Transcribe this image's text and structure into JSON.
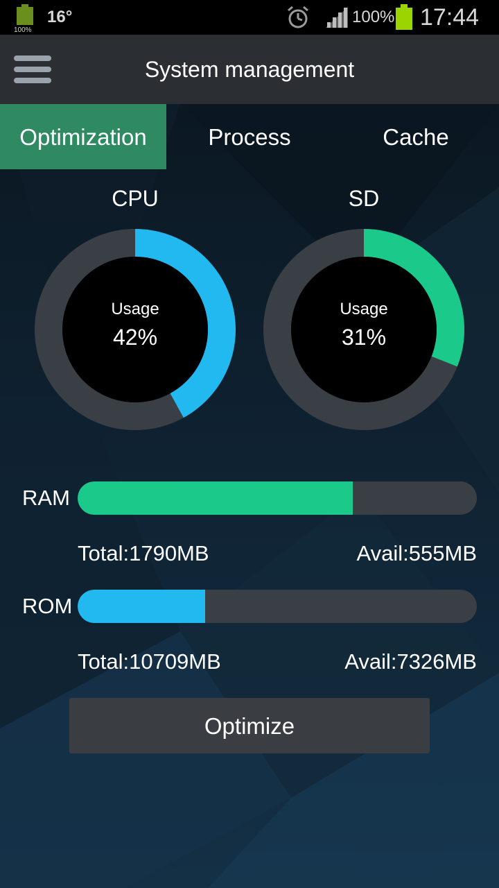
{
  "status_bar": {
    "battery_small_label": "100%",
    "temperature": "16°",
    "signal_percent": "100%",
    "time": "17:44",
    "icons": [
      "battery-icon",
      "alarm-icon",
      "signal-icon",
      "battery-icon"
    ],
    "battery_color": "#9bd400"
  },
  "app_bar": {
    "title": "System management",
    "menu_icon": "menu-icon"
  },
  "tabs": [
    {
      "label": "Optimization",
      "active": true
    },
    {
      "label": "Process",
      "active": false
    },
    {
      "label": "Cache",
      "active": false
    }
  ],
  "gauges": [
    {
      "name": "CPU",
      "usage_label": "Usage",
      "value_text": "42%",
      "percent": 42,
      "color": "#22b8f0"
    },
    {
      "name": "SD",
      "usage_label": "Usage",
      "value_text": "31%",
      "percent": 31,
      "color": "#1bc98a"
    }
  ],
  "memory": {
    "ram": {
      "label": "RAM",
      "total": "Total:1790MB",
      "avail": "Avail:555MB",
      "used_fraction": 0.69,
      "color": "#1bc98a"
    },
    "rom": {
      "label": "ROM",
      "total": "Total:10709MB",
      "avail": "Avail:7326MB",
      "used_fraction": 0.32,
      "color": "#22b8f0"
    }
  },
  "actions": {
    "optimize_label": "Optimize"
  },
  "colors": {
    "tab_active": "#2f8a62",
    "track": "#3a3f45",
    "appbar": "#2b2f33"
  }
}
